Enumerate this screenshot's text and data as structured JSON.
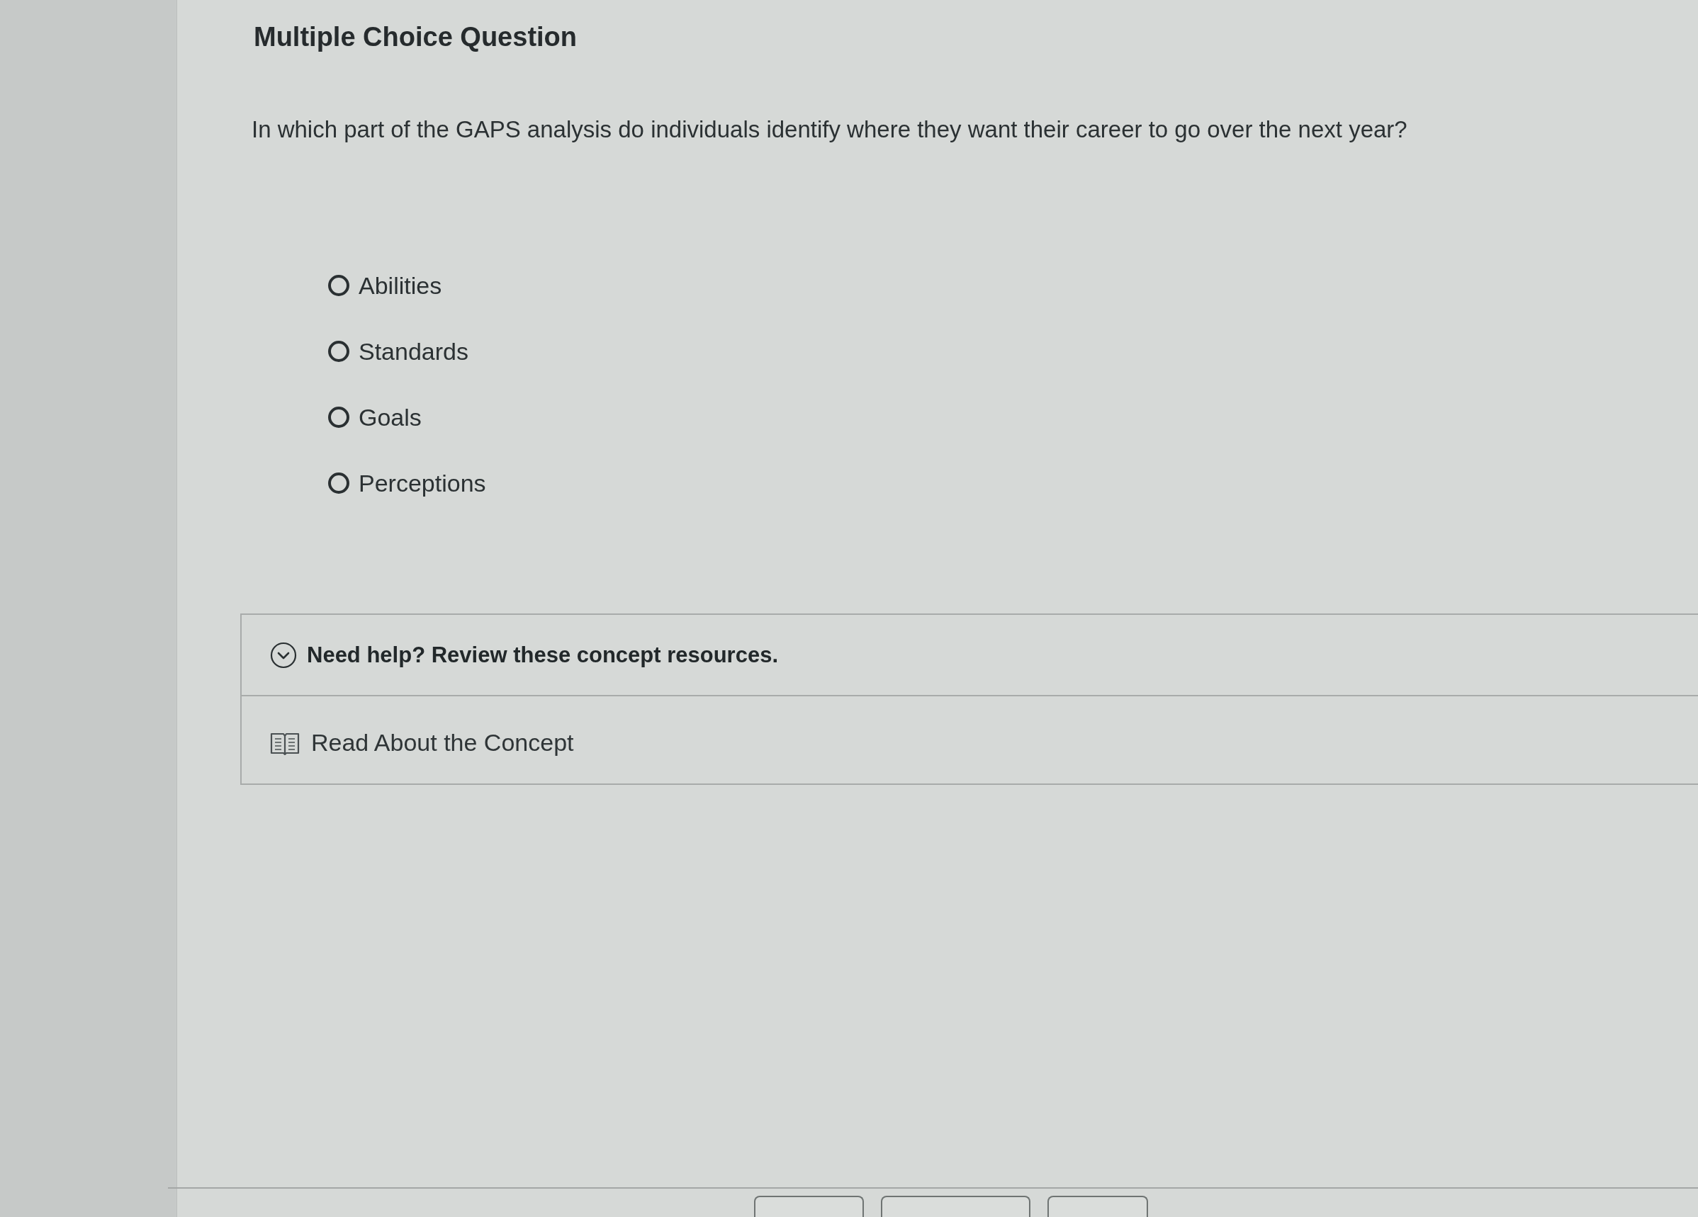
{
  "question": {
    "heading": "Multiple Choice Question",
    "prompt": "In which part of the GAPS analysis do individuals identify where they want their career to go over the next year?"
  },
  "options": [
    {
      "label": "Abilities",
      "selected": false
    },
    {
      "label": "Standards",
      "selected": false
    },
    {
      "label": "Goals",
      "selected": false
    },
    {
      "label": "Perceptions",
      "selected": false
    }
  ],
  "help": {
    "title": "Need help? Review these concept resources.",
    "expanded": true,
    "resources": [
      {
        "label": "Read About the Concept"
      }
    ]
  }
}
